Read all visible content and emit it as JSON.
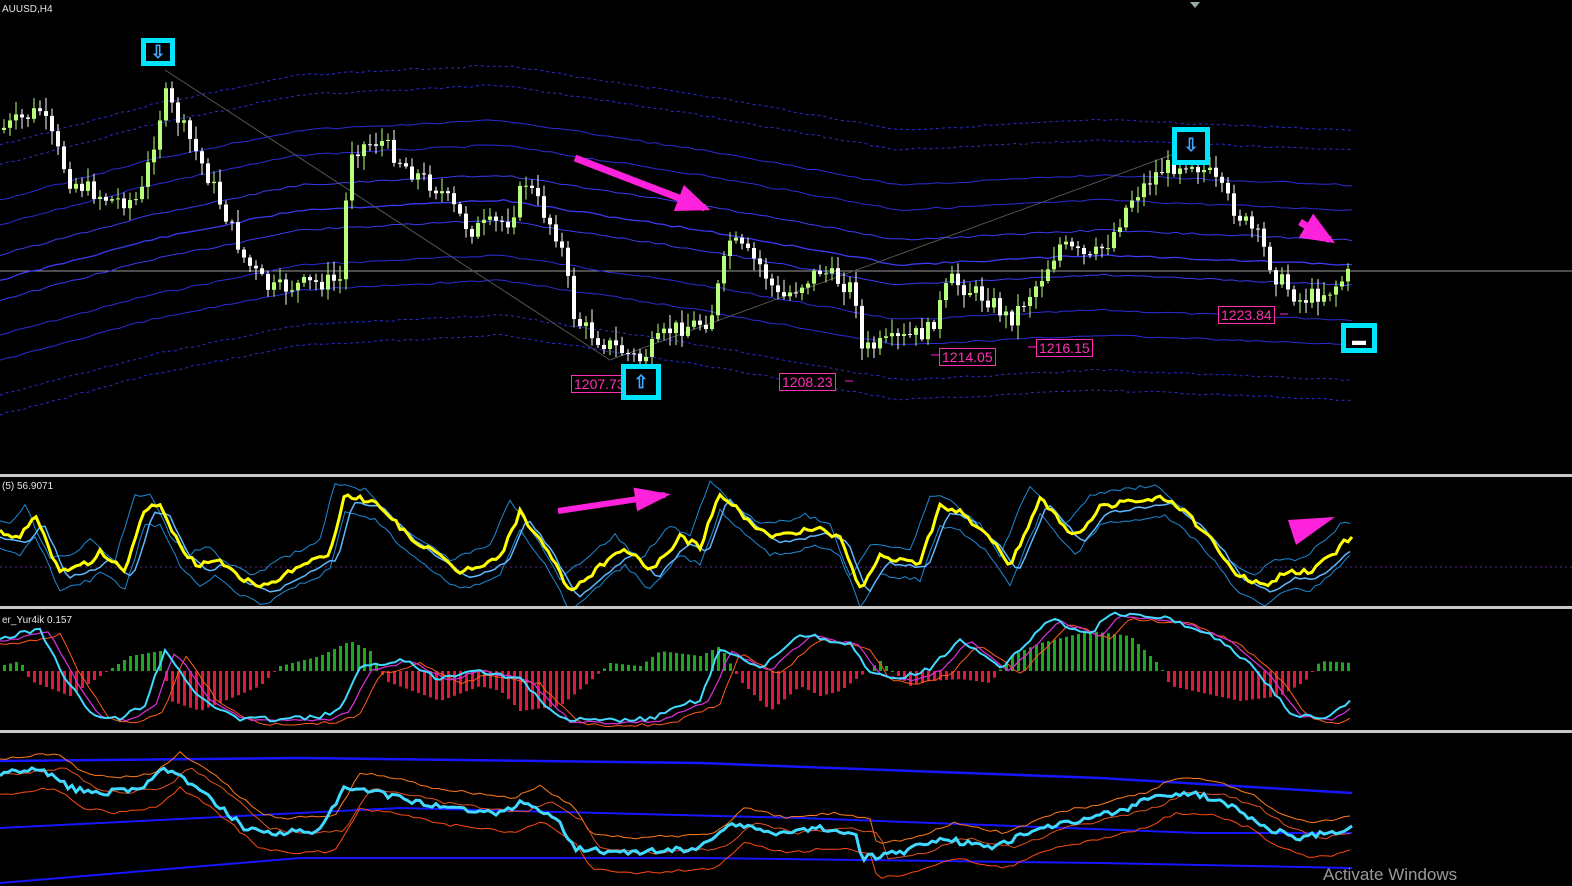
{
  "symbol_title": "AUUSD,H4",
  "indicator1_title": "(5) 56.9071",
  "indicator2_title": "er_Yur4ik 0.157",
  "price_labels": [
    "1207.73",
    "1208.23",
    "1214.05",
    "1216.15",
    "1223.84"
  ],
  "watermark": "Activate Windows",
  "colors": {
    "bull_candle": "#b7ff7a",
    "bear_candle": "#ffffff",
    "band_blue": "#2b2bd6",
    "marker": "#00e5ff",
    "arrow_magenta": "#ff22dd",
    "stoch_yellow": "#ffff00",
    "hist_green": "#1fa81f",
    "hist_red": "#e0183a",
    "line_cyan": "#41d9ff"
  },
  "markers": [
    {
      "name": "sell-signal-1",
      "icon": "arrow-down-icon",
      "glyph": "⇩"
    },
    {
      "name": "buy-signal-1",
      "icon": "arrow-up-icon",
      "glyph": "⇧"
    },
    {
      "name": "sell-signal-2",
      "icon": "arrow-down-icon",
      "glyph": "⇩"
    },
    {
      "name": "pending-signal",
      "icon": "square-icon",
      "glyph": "▬"
    }
  ]
}
